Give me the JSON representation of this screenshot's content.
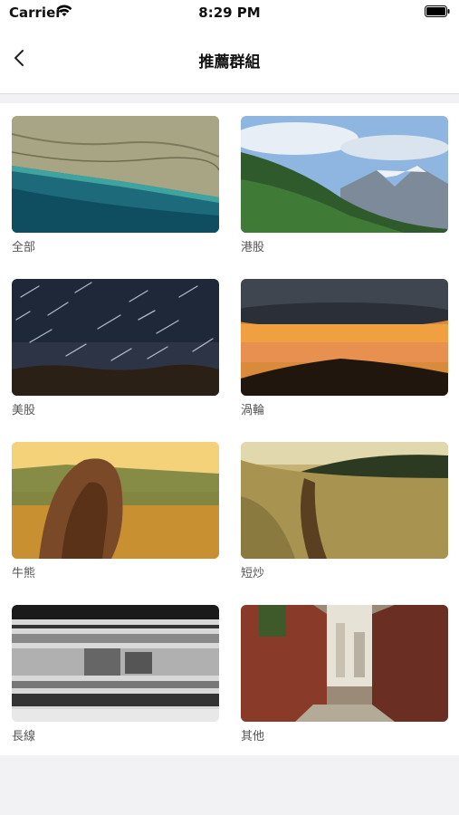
{
  "status": {
    "carrier": "Carrier",
    "time": "8:29 PM"
  },
  "nav": {
    "title": "推薦群組",
    "back_icon": "chevron-left-icon"
  },
  "groups": [
    {
      "label": "全部",
      "image": "aerial-coast-photo"
    },
    {
      "label": "港股",
      "image": "mountain-forest-photo"
    },
    {
      "label": "美股",
      "image": "star-trails-photo"
    },
    {
      "label": "渦輪",
      "image": "sunset-hills-photo"
    },
    {
      "label": "牛熊",
      "image": "girl-wheat-field-photo"
    },
    {
      "label": "短炒",
      "image": "meadow-path-photo"
    },
    {
      "label": "長線",
      "image": "motion-blur-train-photo"
    },
    {
      "label": "其他",
      "image": "brick-alley-photo"
    }
  ]
}
